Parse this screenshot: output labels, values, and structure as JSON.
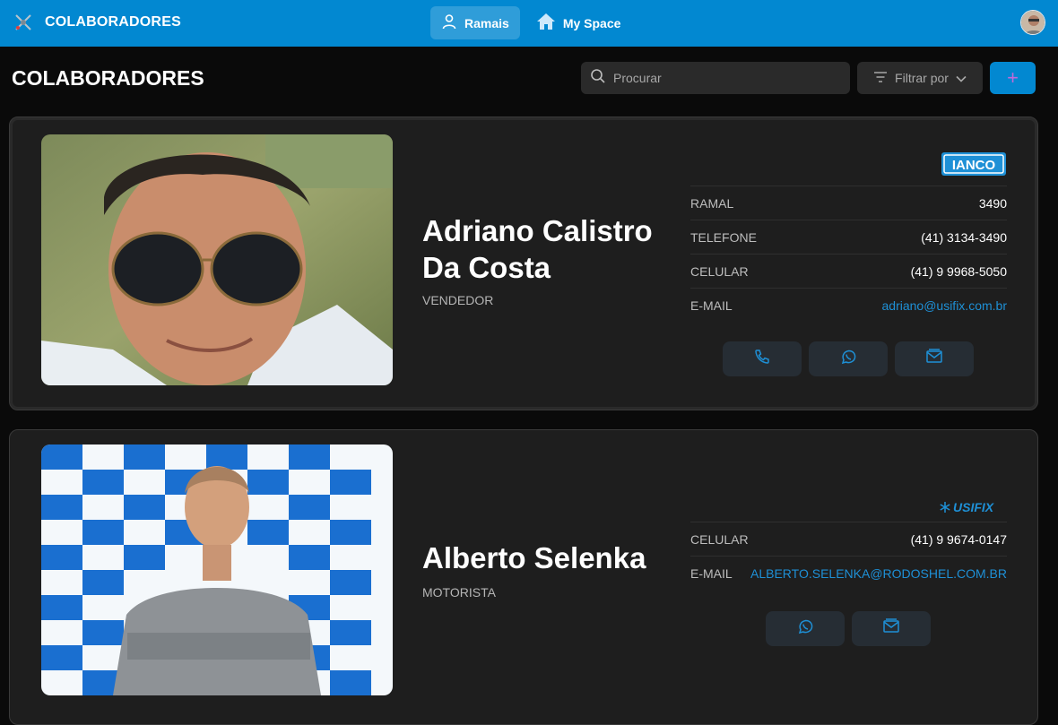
{
  "app": {
    "title": "COLABORADORES",
    "logo_icon": "flower-logo-icon"
  },
  "nav": {
    "items": [
      {
        "label": "Ramais",
        "icon": "person-icon",
        "active": true
      },
      {
        "label": "My Space",
        "icon": "home-icon",
        "active": false
      }
    ]
  },
  "page": {
    "title": "COLABORADORES"
  },
  "search": {
    "placeholder": "Procurar",
    "value": ""
  },
  "filter": {
    "label": "Filtrar por"
  },
  "add_button": {
    "label": "+"
  },
  "colors": {
    "brand": "#0288d1",
    "link": "#1e90d6",
    "background": "#0a0a0a",
    "card": "#1e1e1e"
  },
  "employees": [
    {
      "name_line1": "Adriano Calistro",
      "name_line2": "Da Costa",
      "role": "VENDEDOR",
      "company": "IANCO",
      "fields": [
        {
          "label": "RAMAL",
          "value": "3490"
        },
        {
          "label": "TELEFONE",
          "value": "(41) 3134-3490"
        },
        {
          "label": "CELULAR",
          "value": "(41) 9 9968-5050"
        },
        {
          "label": "E-MAIL",
          "value": "adriano@usifix.com.br"
        }
      ],
      "actions": [
        "phone-icon",
        "whatsapp-icon",
        "mail-icon"
      ]
    },
    {
      "name_line1": "Alberto Selenka",
      "role": "MOTORISTA",
      "company": "USIFIX",
      "fields": [
        {
          "label": "CELULAR",
          "value": "(41) 9 9674-0147"
        },
        {
          "label": "E-MAIL",
          "value": "ALBERTO.SELENKA@RODOSHEL.COM.BR"
        }
      ],
      "actions": [
        "whatsapp-icon",
        "mail-icon"
      ]
    }
  ]
}
